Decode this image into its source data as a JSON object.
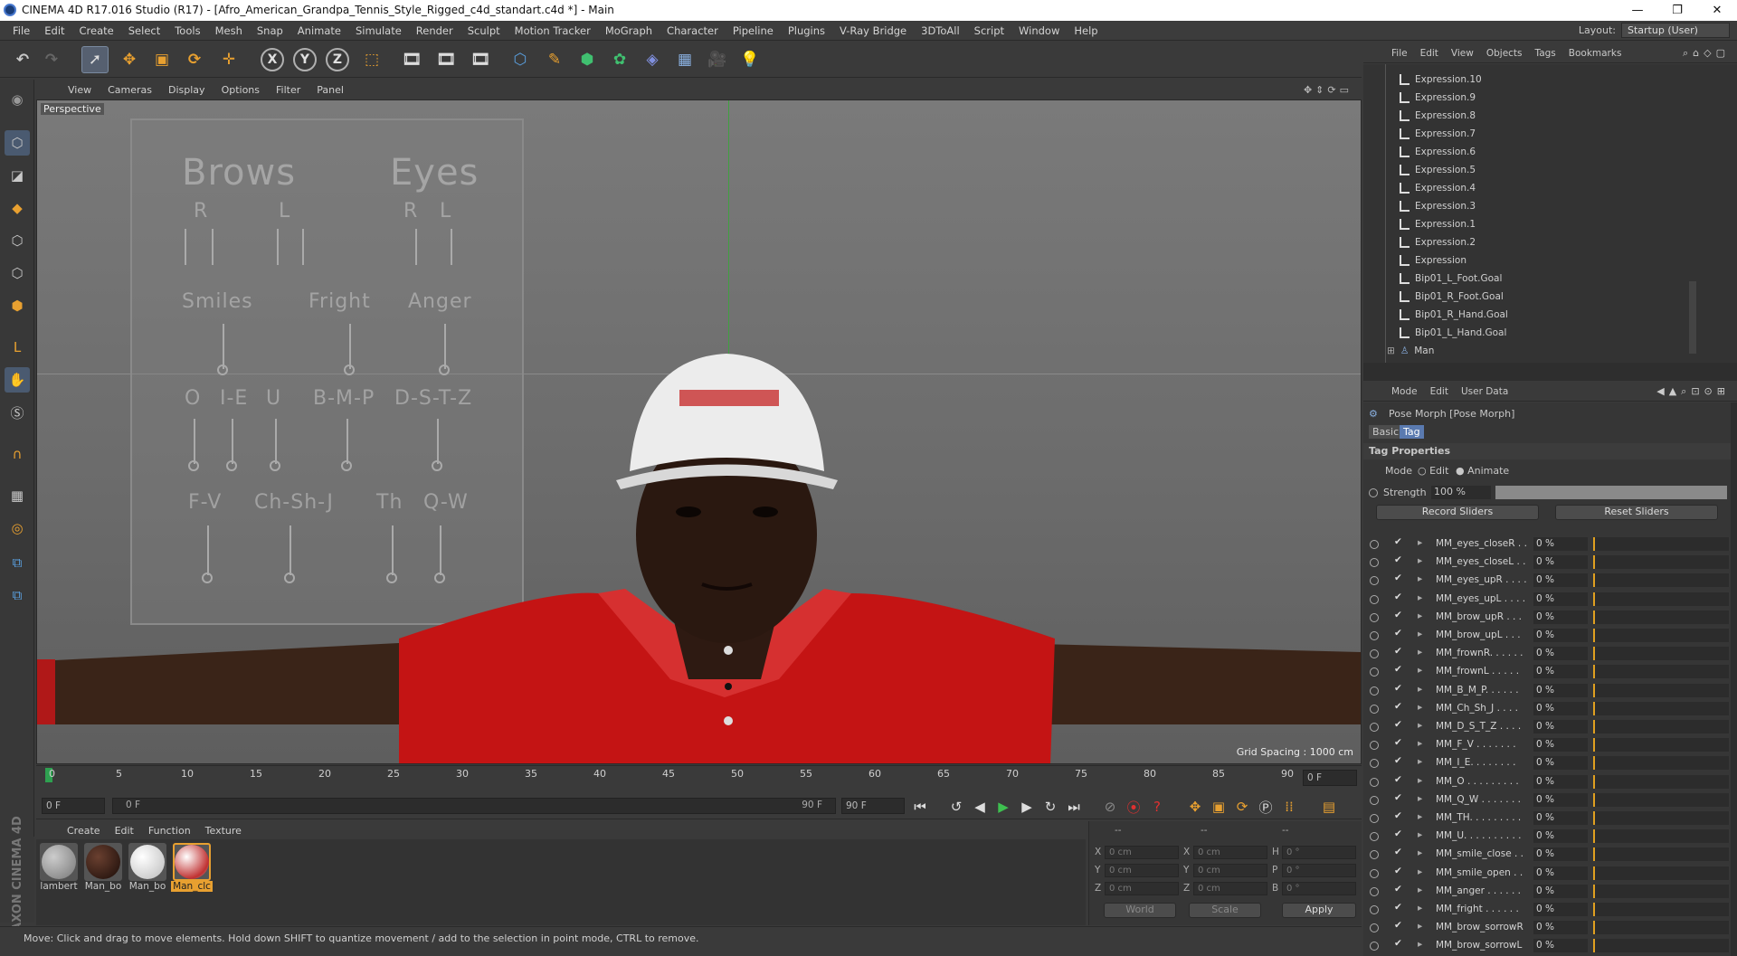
{
  "window": {
    "title": "CINEMA 4D R17.016 Studio (R17) - [Afro_American_Grandpa_Tennis_Style_Rigged_c4d_standart.c4d *] - Main",
    "controls": [
      "—",
      "❐",
      "✕"
    ]
  },
  "menubar": {
    "items": [
      "File",
      "Edit",
      "Create",
      "Select",
      "Tools",
      "Mesh",
      "Snap",
      "Animate",
      "Simulate",
      "Render",
      "Sculpt",
      "Motion Tracker",
      "MoGraph",
      "Character",
      "Pipeline",
      "Plugins",
      "V-Ray Bridge",
      "3DToAll",
      "Script",
      "Window",
      "Help"
    ],
    "layout_label": "Layout:",
    "layout_value": "Startup (User)"
  },
  "toolbar": {
    "axis_x": "X",
    "axis_y": "Y",
    "axis_z": "Z"
  },
  "viewport": {
    "menu": [
      "View",
      "Cameras",
      "Display",
      "Options",
      "Filter",
      "Panel"
    ],
    "camera_label": "Perspective",
    "grid_spacing": "Grid Spacing : 1000 cm",
    "panel": {
      "brows": "Brows",
      "eyes": "Eyes",
      "r1": "R",
      "l1": "L",
      "r2": "R",
      "l2": "L",
      "smiles": "Smiles",
      "fright": "Fright",
      "anger": "Anger",
      "o": "O",
      "ie": "I-E",
      "u": "U",
      "bmp": "B-M-P",
      "dstz": "D-S-T-Z",
      "fv": "F-V",
      "chshj": "Ch-Sh-J",
      "th": "Th",
      "qw": "Q-W"
    }
  },
  "timeline": {
    "ticks": [
      "0",
      "5",
      "10",
      "15",
      "20",
      "25",
      "30",
      "35",
      "40",
      "45",
      "50",
      "55",
      "60",
      "65",
      "70",
      "75",
      "80",
      "85",
      "90"
    ],
    "current_frame": "0 F",
    "start_frame": "0 F",
    "range_start": "0 F",
    "range_end": "90 F",
    "end_frame": "90 F"
  },
  "materials": {
    "menu": [
      "Create",
      "Edit",
      "Function",
      "Texture"
    ],
    "items": [
      {
        "name": "lambert",
        "color": "#9a9a9a",
        "selected": false
      },
      {
        "name": "Man_bo",
        "color": "#3a2018",
        "selected": false
      },
      {
        "name": "Man_bo",
        "color": "#dcdcdc",
        "selected": false
      },
      {
        "name": "Man_clc",
        "color": "#c8c8c8",
        "selected": true
      }
    ]
  },
  "coords": {
    "header": [
      "--",
      "--",
      "--"
    ],
    "rows": [
      {
        "a": "X",
        "av": "0 cm",
        "b": "X",
        "bv": "0 cm",
        "c": "H",
        "cv": "0 °"
      },
      {
        "a": "Y",
        "av": "0 cm",
        "b": "Y",
        "bv": "0 cm",
        "c": "P",
        "cv": "0 °"
      },
      {
        "a": "Z",
        "av": "0 cm",
        "b": "Z",
        "bv": "0 cm",
        "c": "B",
        "cv": "0 °"
      }
    ],
    "space": "World",
    "mode": "Scale",
    "apply": "Apply"
  },
  "status": {
    "text": "Move: Click and drag to move elements. Hold down SHIFT to quantize movement / add to the selection in point mode, CTRL to remove."
  },
  "maxon": "MAXON CINEMA 4D",
  "objects": {
    "menu": [
      "File",
      "Edit",
      "View",
      "Objects",
      "Tags",
      "Bookmarks"
    ],
    "items": [
      "Expression.10",
      "Expression.9",
      "Expression.8",
      "Expression.7",
      "Expression.6",
      "Expression.5",
      "Expression.4",
      "Expression.3",
      "Expression.1",
      "Expression.2",
      "Expression",
      "Bip01_L_Foot.Goal",
      "Bip01_R_Foot.Goal",
      "Bip01_R_Hand.Goal",
      "Bip01_L_Hand.Goal",
      "Man"
    ]
  },
  "attributes": {
    "menu": [
      "Mode",
      "Edit",
      "User Data"
    ],
    "object_title": "Pose Morph [Pose Morph]",
    "tabs": [
      "Basic",
      "Tag"
    ],
    "section": "Tag Properties",
    "mode_label": "Mode",
    "mode_edit": "Edit",
    "mode_animate": "Animate",
    "strength_label": "Strength",
    "strength_value": "100 %",
    "record_sliders": "Record Sliders",
    "reset_sliders": "Reset Sliders",
    "morphs": [
      {
        "name": "MM_eyes_closeR . .",
        "value": "0 %"
      },
      {
        "name": "MM_eyes_closeL . .",
        "value": "0 %"
      },
      {
        "name": "MM_eyes_upR . . . .",
        "value": "0 %"
      },
      {
        "name": "MM_eyes_upL . . . .",
        "value": "0 %"
      },
      {
        "name": "MM_brow_upR . . .",
        "value": "0 %"
      },
      {
        "name": "MM_brow_upL . . .",
        "value": "0 %"
      },
      {
        "name": "MM_frownR. . . . . .",
        "value": "0 %"
      },
      {
        "name": "MM_frownL . . . . .",
        "value": "0 %"
      },
      {
        "name": "MM_B_M_P. . . . . .",
        "value": "0 %"
      },
      {
        "name": "MM_Ch_Sh_J . . . .",
        "value": "0 %"
      },
      {
        "name": "MM_D_S_T_Z . . . .",
        "value": "0 %"
      },
      {
        "name": "MM_F_V . . . . . . .",
        "value": "0 %"
      },
      {
        "name": "MM_I_E. . . . . . . .",
        "value": "0 %"
      },
      {
        "name": "MM_O . . . . . . . . .",
        "value": "0 %"
      },
      {
        "name": "MM_Q_W . . . . . . .",
        "value": "0 %"
      },
      {
        "name": "MM_TH. . . . . . . . .",
        "value": "0 %"
      },
      {
        "name": "MM_U. . . . . . . . . .",
        "value": "0 %"
      },
      {
        "name": "MM_smile_close . .",
        "value": "0 %"
      },
      {
        "name": "MM_smile_open . .",
        "value": "0 %"
      },
      {
        "name": "MM_anger . . . . . .",
        "value": "0 %"
      },
      {
        "name": "MM_fright . . . . . .",
        "value": "0 %"
      },
      {
        "name": "MM_brow_sorrowR",
        "value": "0 %"
      },
      {
        "name": "MM_brow_sorrowL",
        "value": "0 %"
      }
    ]
  }
}
